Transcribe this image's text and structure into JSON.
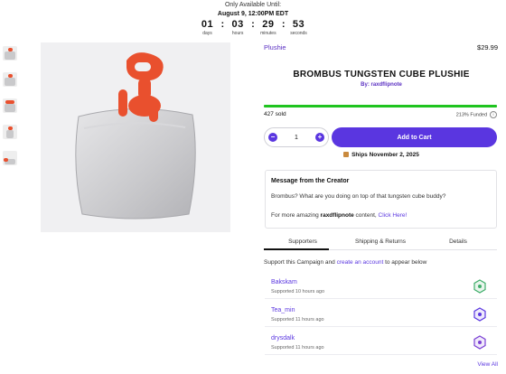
{
  "countdown": {
    "heading": "Only Available Until:",
    "deadline": "August 9, 12:00PM EDT",
    "units": [
      {
        "value": "01",
        "label": "days"
      },
      {
        "value": "03",
        "label": "hours"
      },
      {
        "value": "29",
        "label": "minutes"
      },
      {
        "value": "53",
        "label": "seconds"
      }
    ],
    "separator": ":"
  },
  "product": {
    "category": "Plushie",
    "price": "$29.99",
    "title": "BROMBUS TUNGSTEN CUBE PLUSHIE",
    "byline": "By: raxdflipnote",
    "sold": "427 sold",
    "funded": "213% Funded",
    "funded_fraction": 1.0,
    "info_glyph": "i",
    "quantity": "1",
    "minus": "−",
    "plus": "+",
    "add_to_cart": "Add to Cart",
    "ships": "Ships November 2, 2025"
  },
  "message": {
    "title": "Message from the Creator",
    "body1": "Brombus? What are you doing on top of that tungsten cube buddy?",
    "body2_pre": "For more amazing ",
    "body2_bold": "raxdflipnote",
    "body2_mid": " content, ",
    "body2_link": "Click Here!"
  },
  "tabs": [
    "Supporters",
    "Shipping & Returns",
    "Details"
  ],
  "supporters": {
    "note_pre": "Support this Campaign and ",
    "note_link": "create an account",
    "note_post": " to appear below",
    "rows": [
      {
        "name": "Bakskam",
        "time": "Supported 10 hours ago",
        "badge_color": "#3fae6a"
      },
      {
        "name": "Tea_min",
        "time": "Supported 11 hours ago",
        "badge_color": "#5a36e0"
      },
      {
        "name": "drysdalk",
        "time": "Supported 11 hours ago",
        "badge_color": "#7a3fd4"
      }
    ],
    "view_all": "View All"
  },
  "colors": {
    "accent": "#5a36e0",
    "progress": "#1fc41f",
    "handle": "#e9502e"
  }
}
